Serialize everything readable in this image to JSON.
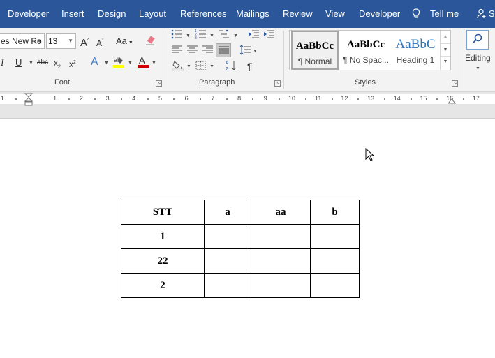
{
  "tabs": [
    "Developer",
    "Insert",
    "Design",
    "Layout",
    "References",
    "Mailings",
    "Review",
    "View",
    "Developer",
    "Tell me",
    "S"
  ],
  "font": {
    "name": "es New Ro",
    "size": "13",
    "group_label": "Font",
    "case_label": "Aa"
  },
  "paragraph": {
    "group_label": "Paragraph"
  },
  "styles": {
    "group_label": "Styles",
    "items": [
      {
        "preview": "AaBbCc",
        "name": "¶ Normal"
      },
      {
        "preview": "AaBbCc",
        "name": "¶ No Spac..."
      },
      {
        "preview": "AaBbC",
        "name": "Heading 1"
      }
    ]
  },
  "editing": {
    "label": "Editing"
  },
  "ruler": {
    "numbers": [
      "1",
      "1",
      "2",
      "3",
      "4",
      "5",
      "6",
      "7",
      "8",
      "9",
      "10",
      "11",
      "12",
      "13",
      "14",
      "15",
      "16",
      "17"
    ]
  },
  "table": {
    "rows": [
      [
        "STT",
        "a",
        "aa",
        "b"
      ],
      [
        "1",
        "",
        "",
        ""
      ],
      [
        "22",
        "",
        "",
        ""
      ],
      [
        "2",
        "",
        "",
        ""
      ]
    ]
  },
  "colors": {
    "ribbon_tab_bg": "#2b579a",
    "font_color": "#d00000",
    "highlight": "#ffff00",
    "style_heading": "#2e74b5"
  }
}
